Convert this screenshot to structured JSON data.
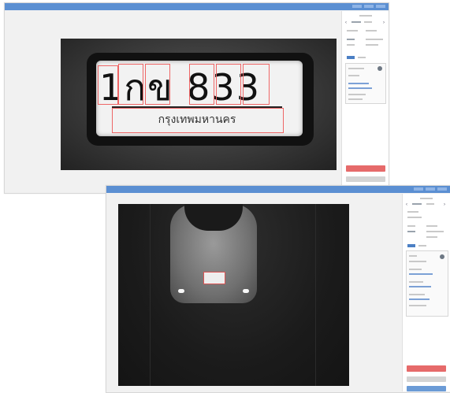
{
  "window1": {
    "title": "",
    "canvas_label": "",
    "plate": {
      "main_text": "1กข 833",
      "sub_text": "กรุงเทพมหานคร"
    }
  },
  "window2": {
    "title": "",
    "canvas_label": "",
    "car_plate_text": ""
  },
  "colors": {
    "titlebar": "#5b8fd2",
    "accent_red": "#e66a6a",
    "accent_blue": "#4b7fc4"
  }
}
